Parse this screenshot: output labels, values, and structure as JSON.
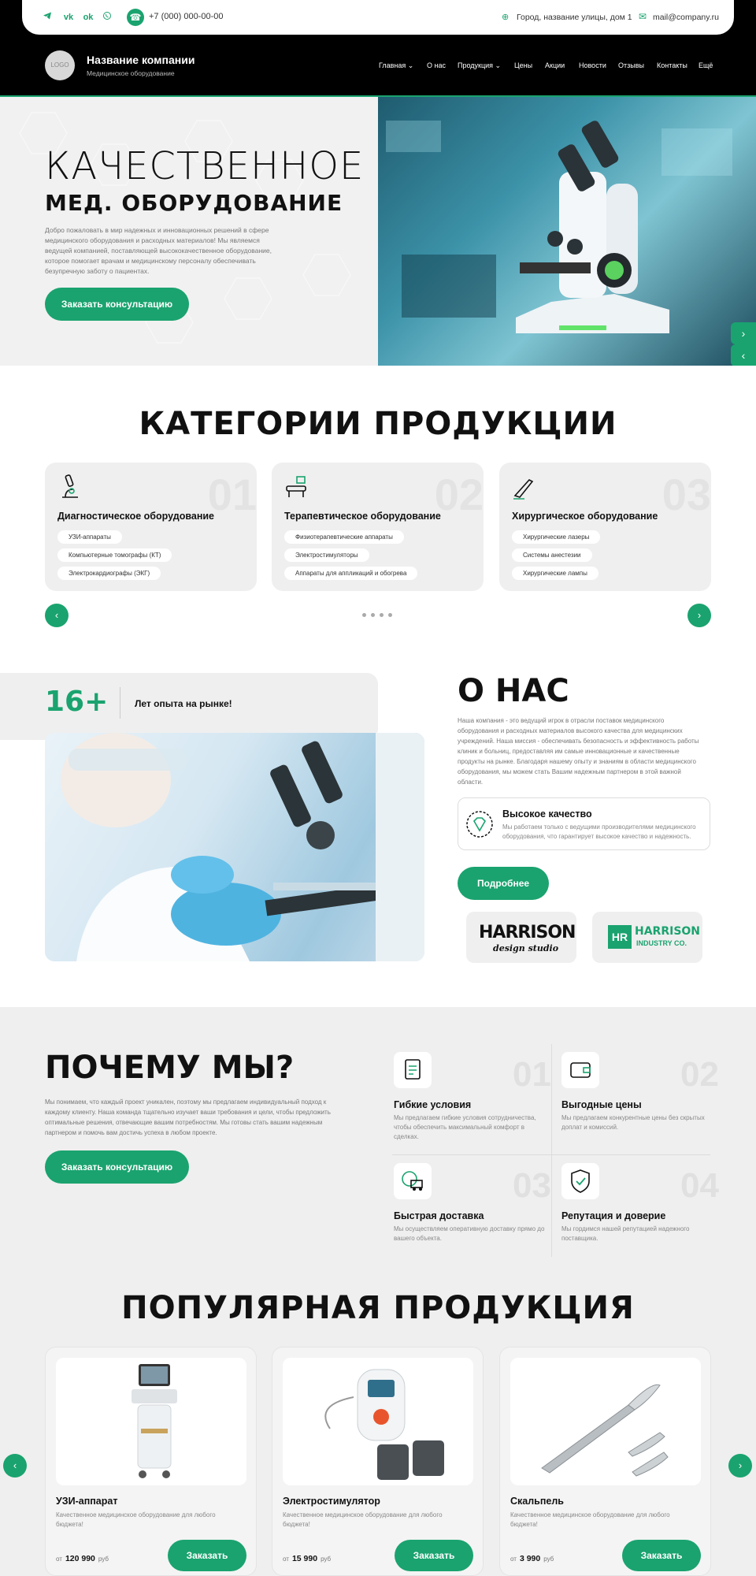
{
  "topbar": {
    "social": [
      "telegram-icon",
      "vk-icon",
      "ok-icon",
      "whatsapp-icon"
    ],
    "phone": "+7 (000) 000-00-00",
    "address": "Город, название улицы, дом 1",
    "email": "mail@company.ru"
  },
  "header": {
    "logo": "LOGO",
    "company_name": "Название компании",
    "company_sub": "Медицинское оборудование",
    "nav": [
      "Главная",
      "О нас",
      "Продукция",
      "Цены",
      "Акции",
      "Новости",
      "Отзывы",
      "Контакты",
      "Ещё"
    ]
  },
  "hero": {
    "title_line1": "КАЧЕСТВЕННОЕ",
    "title_line2": "МЕД. ОБОРУДОВАНИЕ",
    "text": "Добро пожаловать в мир надежных и инновационных решений в сфере медицинского оборудования и расходных материалов! Мы являемся ведущей компанией, поставляющей высококачественное оборудование, которое помогает врачам и медицинскому персоналу обеспечивать безупречную заботу о пациентах.",
    "button": "Заказать консультацию"
  },
  "categories": {
    "title": "КАТЕГОРИИ ПРОДУКЦИИ",
    "items": [
      {
        "num": "01",
        "title": "Диагностическое оборудование",
        "tags": [
          "УЗИ-аппараты",
          "Компьютерные томографы (КТ)",
          "Электрокардиографы (ЭКГ)"
        ]
      },
      {
        "num": "02",
        "title": "Терапевтическое оборудование",
        "tags": [
          "Физиотерапевтические аппараты",
          "Электростимуляторы",
          "Аппараты для аппликаций и обогрева"
        ]
      },
      {
        "num": "03",
        "title": "Хирургическое оборудование",
        "tags": [
          "Хирургические лазеры",
          "Системы анестезии",
          "Хирургические лампы"
        ]
      }
    ]
  },
  "about": {
    "stat_num": "16+",
    "stat_text": "Лет опыта на рынке!",
    "title": "О НАС",
    "text": "Наша компания - это ведущий игрок в отрасли поставок медицинского оборудования и расходных материалов высокого качества для медицинских учреждений. Наша миссия - обеспечивать безопасность и эффективность работы клиник и больниц, предоставляя им самые инновационные и качественные продукты на рынке. Благодаря нашему опыту и знаниям в области медицинского оборудования, мы можем стать Вашим надежным партнером в этой важной области.",
    "quality_title": "Высокое качество",
    "quality_text": "Мы работаем только с ведущими производителями медицинского оборудования, что гарантирует высокое качество и надежность.",
    "button": "Подробнее",
    "partner1_name": "HARRISON",
    "partner1_sub": "design studio",
    "partner2_mark": "HR",
    "partner2_name": "HARRISON",
    "partner2_sub": "INDUSTRY CO."
  },
  "why": {
    "title": "ПОЧЕМУ МЫ?",
    "text": "Мы понимаем, что каждый проект уникален, поэтому мы предлагаем индивидуальный подход к каждому клиенту. Наша команда тщательно изучает ваши требования и цели, чтобы предложить оптимальные решения, отвечающие вашим потребностям. Мы готовы стать вашим надежным партнером и помочь вам достичь успеха в любом проекте.",
    "button": "Заказать консультацию",
    "features": [
      {
        "num": "01",
        "title": "Гибкие условия",
        "text": "Мы предлагаем гибкие условия сотрудничества, чтобы обеспечить максимальный комфорт в сделках."
      },
      {
        "num": "02",
        "title": "Выгодные цены",
        "text": "Мы предлагаем конкурентные цены без скрытых доплат и комиссий."
      },
      {
        "num": "03",
        "title": "Быстрая доставка",
        "text": "Мы осуществляем оперативную доставку прямо до вашего объекта."
      },
      {
        "num": "04",
        "title": "Репутация и доверие",
        "text": "Мы гордимся нашей репутацией надежного поставщика."
      }
    ]
  },
  "products": {
    "title": "ПОПУЛЯРНАЯ ПРОДУКЦИЯ",
    "items": [
      {
        "name": "УЗИ-аппарат",
        "desc": "Качественное медицинское оборудование для любого бюджета!",
        "from": "от",
        "price": "120 990",
        "currency": "руб",
        "button": "Заказать"
      },
      {
        "name": "Электростимулятор",
        "desc": "Качественное медицинское оборудование для любого бюджета!",
        "from": "от",
        "price": "15 990",
        "currency": "руб",
        "button": "Заказать"
      },
      {
        "name": "Скальпель",
        "desc": "Качественное медицинское оборудование для любого бюджета!",
        "from": "от",
        "price": "3 990",
        "currency": "руб",
        "button": "Заказать"
      }
    ]
  },
  "colors": {
    "accent": "#1aa36f",
    "dark": "#000000",
    "light_bg": "#efefef"
  }
}
